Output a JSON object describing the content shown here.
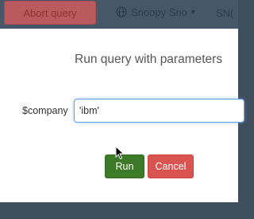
{
  "topbar": {
    "abort_label": "Abort query",
    "user_label": "Snoopy Sno",
    "user_icon": "globe-icon",
    "caret_icon": "caret-down-icon",
    "trailing_text": "SN("
  },
  "modal": {
    "title": "Run query with parameters",
    "params": [
      {
        "label": "$company",
        "value": "'ibm'"
      }
    ],
    "run_label": "Run",
    "cancel_label": "Cancel"
  },
  "colors": {
    "run": "#3d7a27",
    "cancel": "#d9534f",
    "focus": "#66a3e0"
  }
}
